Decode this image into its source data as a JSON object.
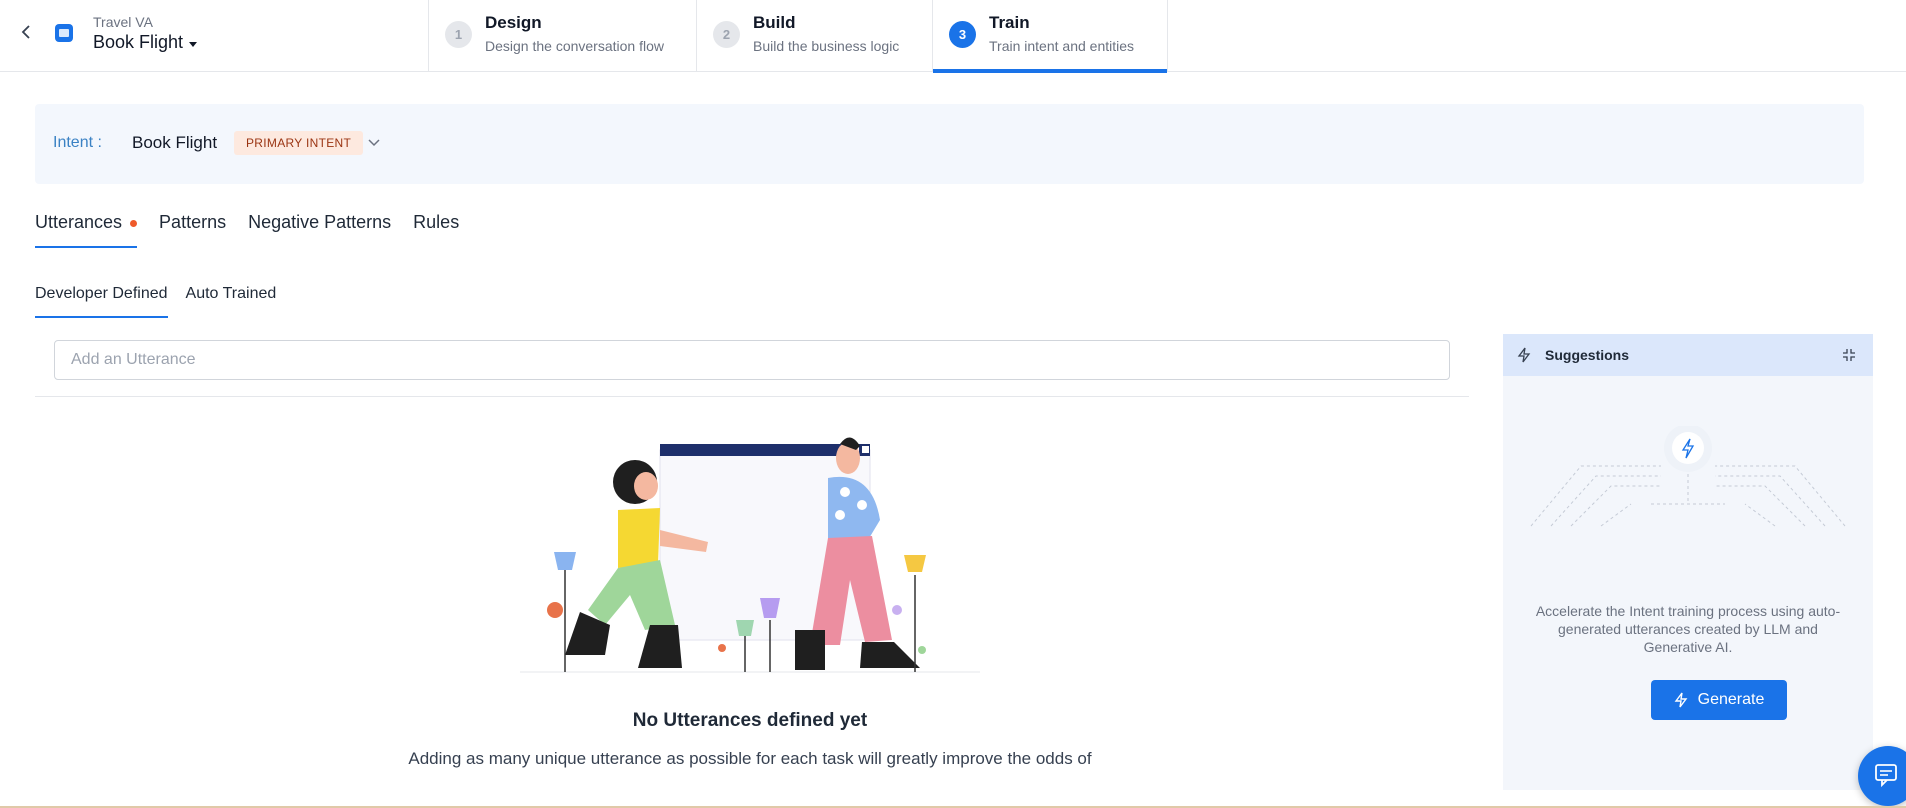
{
  "header": {
    "app_subtitle": "Travel VA",
    "app_name": "Book Flight",
    "steps": [
      {
        "number": "1",
        "title": "Design",
        "description": "Design the conversation flow"
      },
      {
        "number": "2",
        "title": "Build",
        "description": "Build the business logic"
      },
      {
        "number": "3",
        "title": "Train",
        "description": "Train intent and entities"
      }
    ],
    "active_step": "3"
  },
  "intent": {
    "label": "Intent :",
    "name": "Book Flight",
    "badge": "PRIMARY INTENT"
  },
  "tabs": [
    {
      "label": "Utterances",
      "active": true,
      "has_dot": true
    },
    {
      "label": "Patterns"
    },
    {
      "label": "Negative Patterns"
    },
    {
      "label": "Rules"
    }
  ],
  "subtabs": [
    {
      "label": "Developer Defined",
      "active": true
    },
    {
      "label": "Auto Trained"
    }
  ],
  "utterance_input": {
    "placeholder": "Add an Utterance",
    "value": ""
  },
  "empty_state": {
    "title": "No Utterances defined yet",
    "description": "Adding as many unique utterance as possible for each task will greatly improve the odds of"
  },
  "suggestions": {
    "title": "Suggestions",
    "description": "Accelerate the Intent training process using auto-generated utterances created by LLM and Generative AI.",
    "button_label": "Generate"
  },
  "icons": {
    "back": "chevron-left-icon",
    "app": "bot-app-icon",
    "bolt": "lightning-icon",
    "collapse": "collapse-icon",
    "chat": "chat-icon"
  },
  "colors": {
    "accent": "#1a73e8",
    "badge_bg": "#fde9df",
    "dot": "#ef5a2a"
  }
}
